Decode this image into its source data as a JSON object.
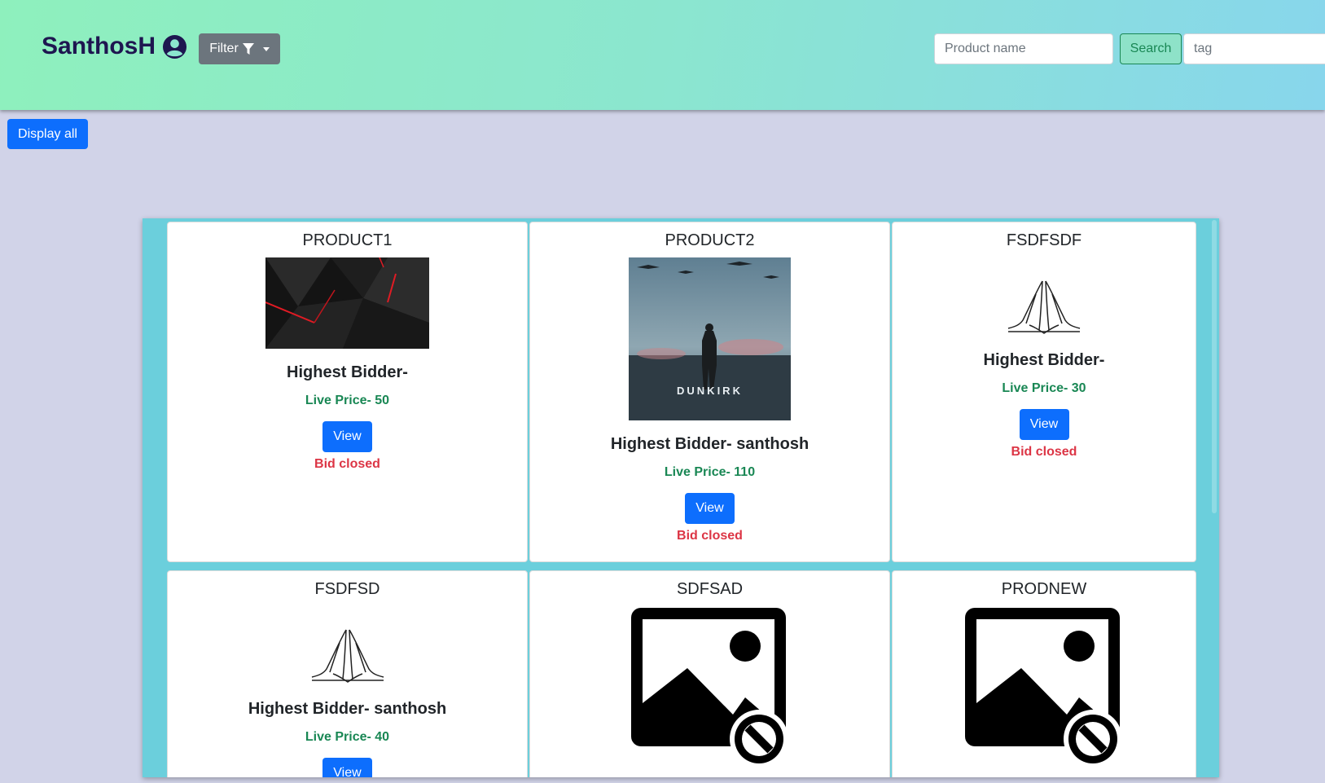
{
  "header": {
    "brand": "SanthosH",
    "filter_label": "Filter",
    "search": {
      "placeholder": "Product name",
      "button": "Search"
    },
    "tag": {
      "placeholder": "tag"
    }
  },
  "toolbar": {
    "display_all": "Display all"
  },
  "products": [
    {
      "name": "PRODUCT1",
      "bidder": "Highest Bidder-",
      "price": "Live Price- 50",
      "view": "View",
      "status": "Bid closed"
    },
    {
      "name": "PRODUCT2",
      "bidder": "Highest Bidder- santhosh",
      "price": "Live Price- 110",
      "view": "View",
      "status": "Bid closed",
      "poster_text": "DUNKIRK"
    },
    {
      "name": "FSDFSDF",
      "bidder": "Highest Bidder-",
      "price": "Live Price- 30",
      "view": "View",
      "status": "Bid closed"
    },
    {
      "name": "FSDFSD",
      "bidder": "Highest Bidder- santhosh",
      "price": "Live Price- 40",
      "view": "View"
    },
    {
      "name": "SDFSAD"
    },
    {
      "name": "PRODNEW"
    }
  ],
  "colors": {
    "brand": "#1e1650",
    "primary": "#0d6efd",
    "price": "#198754",
    "closed": "#dc3545",
    "panel": "#6bcfdc"
  },
  "icons": [
    "user-circle-icon",
    "filter-icon",
    "no-image-icon",
    "praying-hands-image"
  ]
}
